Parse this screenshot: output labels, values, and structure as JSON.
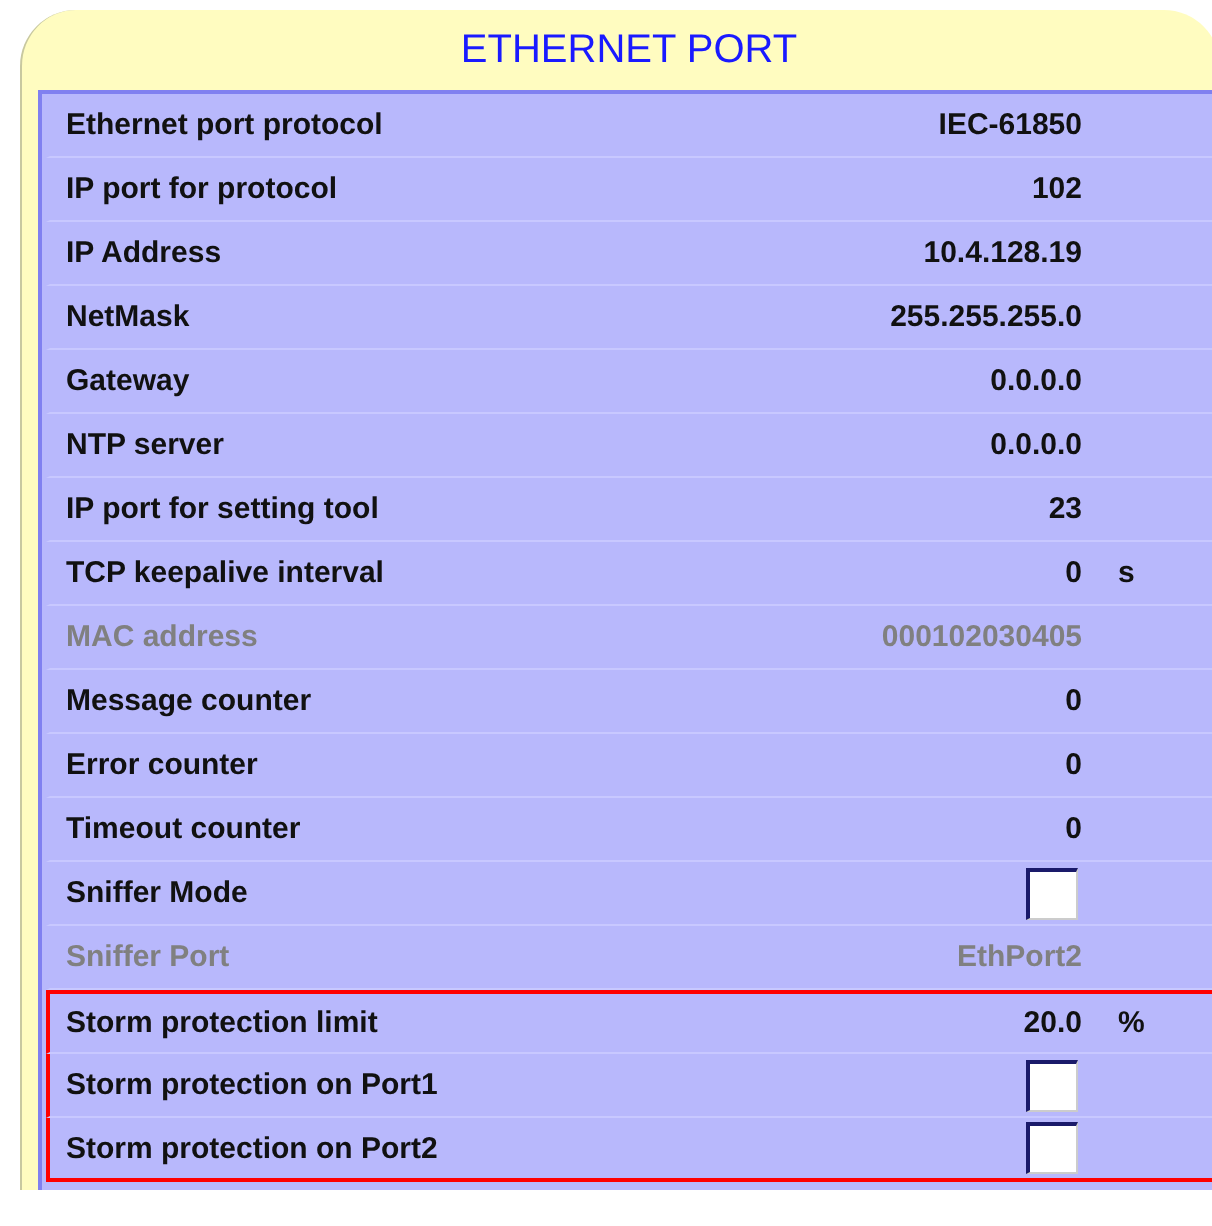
{
  "panel": {
    "title": "ETHERNET PORT"
  },
  "rows": [
    {
      "kind": "text",
      "label": "Ethernet port protocol",
      "value": "IEC-61850",
      "disabled": false,
      "highlighted": false
    },
    {
      "kind": "text",
      "label": "IP port for protocol",
      "value": "102",
      "disabled": false,
      "highlighted": false
    },
    {
      "kind": "text",
      "label": "IP Address",
      "value": "10.4.128.19",
      "disabled": false,
      "highlighted": false
    },
    {
      "kind": "text",
      "label": "NetMask",
      "value": "255.255.255.0",
      "disabled": false,
      "highlighted": false
    },
    {
      "kind": "text",
      "label": "Gateway",
      "value": "0.0.0.0",
      "disabled": false,
      "highlighted": false
    },
    {
      "kind": "text",
      "label": "NTP server",
      "value": "0.0.0.0",
      "disabled": false,
      "highlighted": false
    },
    {
      "kind": "text",
      "label": "IP port for setting tool",
      "value": "23",
      "disabled": false,
      "highlighted": false
    },
    {
      "kind": "text",
      "label": "TCP keepalive interval",
      "value": "0",
      "unit": "s",
      "disabled": false,
      "highlighted": false
    },
    {
      "kind": "text",
      "label": "MAC address",
      "value": "000102030405",
      "disabled": true,
      "highlighted": false
    },
    {
      "kind": "text",
      "label": "Message counter",
      "value": "0",
      "disabled": false,
      "highlighted": false
    },
    {
      "kind": "text",
      "label": "Error counter",
      "value": "0",
      "disabled": false,
      "highlighted": false
    },
    {
      "kind": "text",
      "label": "Timeout counter",
      "value": "0",
      "disabled": false,
      "highlighted": false
    },
    {
      "kind": "checkbox",
      "label": "Sniffer Mode",
      "checked": false,
      "disabled": false,
      "highlighted": false
    },
    {
      "kind": "text",
      "label": "Sniffer Port",
      "value": "EthPort2",
      "disabled": true,
      "highlighted": false
    },
    {
      "kind": "text",
      "label": "Storm protection limit",
      "value": "20.0",
      "unit": "%",
      "disabled": false,
      "highlighted": true
    },
    {
      "kind": "checkbox",
      "label": "Storm protection on Port1",
      "checked": false,
      "disabled": false,
      "highlighted": true
    },
    {
      "kind": "checkbox",
      "label": "Storm protection on Port2",
      "checked": false,
      "disabled": false,
      "highlighted": true
    }
  ]
}
